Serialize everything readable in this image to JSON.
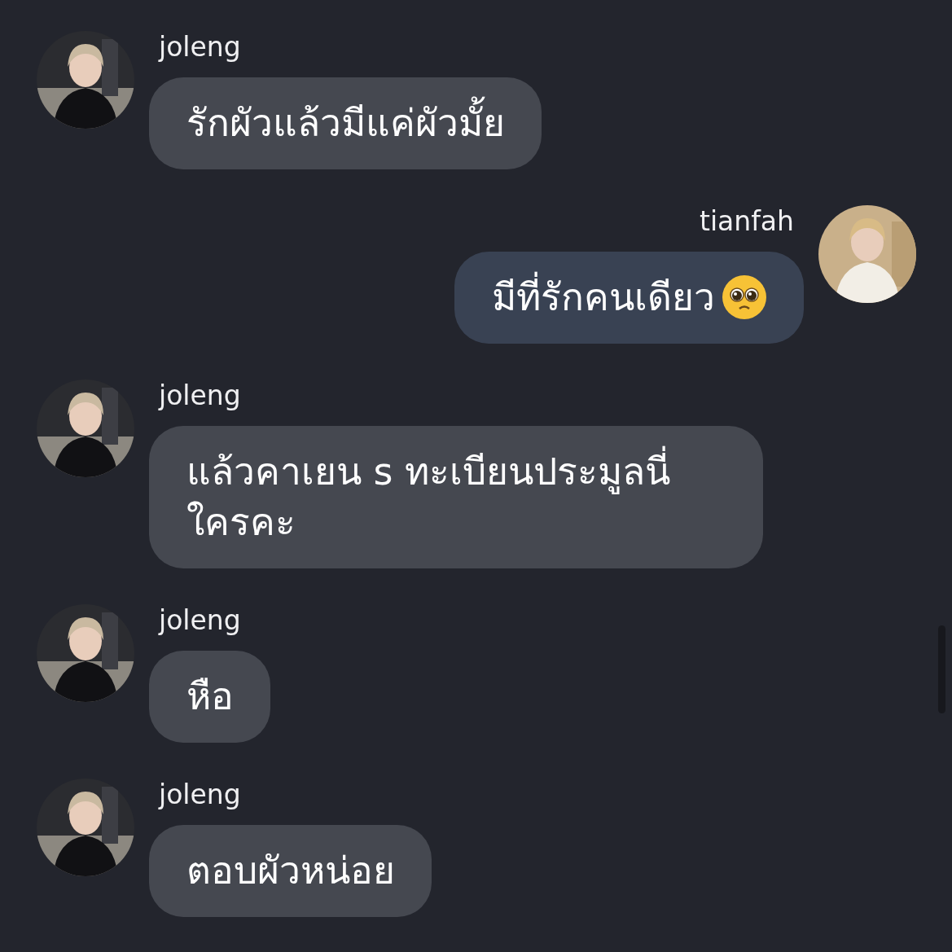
{
  "messages": [
    {
      "kind": "incoming",
      "sender": "joleng",
      "text": "รักผัวแล้วมีแค่ผัวมั้ย",
      "emoji": false
    },
    {
      "kind": "outgoing",
      "sender": "tianfah",
      "text": "มีที่รักคนเดียว",
      "emoji": true
    },
    {
      "kind": "incoming",
      "sender": "joleng",
      "text": "แล้วคาเยน s ทะเบียนประมูลนี่ใครคะ",
      "emoji": false
    },
    {
      "kind": "incoming",
      "sender": "joleng",
      "text": "หือ",
      "emoji": false
    },
    {
      "kind": "incoming",
      "sender": "joleng",
      "text": "ตอบผัวหน่อย",
      "emoji": false
    }
  ]
}
